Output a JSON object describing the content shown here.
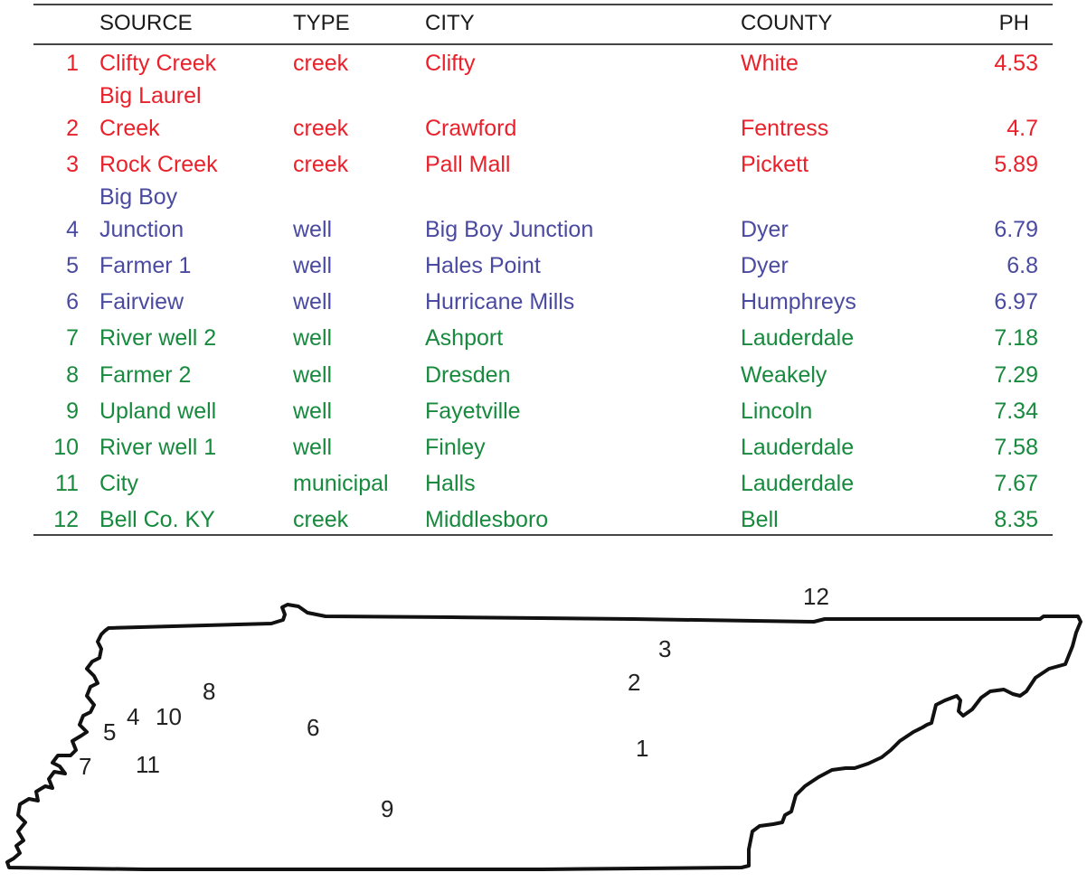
{
  "table": {
    "headers": {
      "source": "SOURCE",
      "type": "TYPE",
      "city": "CITY",
      "county": "COUNTY",
      "ph": "PH"
    },
    "rows": [
      {
        "num": "1",
        "source": "Clifty Creek",
        "type": "creek",
        "city": "Clifty",
        "county": "White",
        "ph": "4.53",
        "group": "red"
      },
      {
        "num": "",
        "source": "Big Laurel",
        "type": "",
        "city": "",
        "county": "",
        "ph": "",
        "group": "red"
      },
      {
        "num": "2",
        "source": "Creek",
        "type": "creek",
        "city": "Crawford",
        "county": "Fentress",
        "ph": "4.7",
        "group": "red"
      },
      {
        "num": "3",
        "source": "Rock Creek",
        "type": "creek",
        "city": "Pall Mall",
        "county": "Pickett",
        "ph": "5.89",
        "group": "red"
      },
      {
        "num": "",
        "source": "Big Boy",
        "type": "",
        "city": "",
        "county": "",
        "ph": "",
        "group": "blue"
      },
      {
        "num": "4",
        "source": "Junction",
        "type": "well",
        "city": "Big Boy Junction",
        "county": "Dyer",
        "ph": "6.79",
        "group": "blue"
      },
      {
        "num": "5",
        "source": "Farmer 1",
        "type": "well",
        "city": "Hales Point",
        "county": "Dyer",
        "ph": "6.8",
        "group": "blue"
      },
      {
        "num": "6",
        "source": "Fairview",
        "type": "well",
        "city": "Hurricane Mills",
        "county": "Humphreys",
        "ph": "6.97",
        "group": "blue"
      },
      {
        "num": "7",
        "source": "River well 2",
        "type": "well",
        "city": "Ashport",
        "county": "Lauderdale",
        "ph": "7.18",
        "group": "green"
      },
      {
        "num": "8",
        "source": "Farmer 2",
        "type": "well",
        "city": "Dresden",
        "county": "Weakely",
        "ph": "7.29",
        "group": "green"
      },
      {
        "num": "9",
        "source": "Upland well",
        "type": "well",
        "city": "Fayetville",
        "county": "Lincoln",
        "ph": "7.34",
        "group": "green"
      },
      {
        "num": "10",
        "source": "River well 1",
        "type": "well",
        "city": "Finley",
        "county": "Lauderdale",
        "ph": "7.58",
        "group": "green"
      },
      {
        "num": "11",
        "source": "City",
        "type": "municipal",
        "city": "Halls",
        "county": "Lauderdale",
        "ph": "7.67",
        "group": "green"
      },
      {
        "num": "12",
        "source": "Bell Co. KY",
        "type": "creek",
        "city": "Middlesboro",
        "county": "Bell",
        "ph": "8.35",
        "group": "green"
      }
    ]
  },
  "colors": {
    "red": "#e8212b",
    "blue": "#4a4aa0",
    "green": "#178a3e"
  },
  "map": {
    "labels": [
      "1",
      "2",
      "3",
      "4",
      "5",
      "6",
      "7",
      "8",
      "9",
      "10",
      "11",
      "12"
    ]
  }
}
